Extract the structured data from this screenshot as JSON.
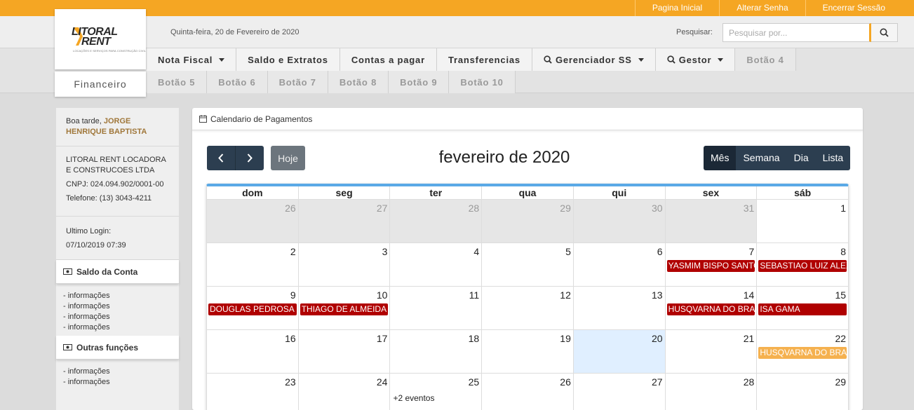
{
  "topbar": {
    "links": [
      "Pagina Inicial",
      "Alterar Senha",
      "Encerrar Sessão"
    ]
  },
  "header": {
    "date": "Quinta-feira, 20 de Fevereiro de 2020",
    "search_label": "Pesquisar:",
    "search_placeholder": "Pesquisar por..."
  },
  "logo": {
    "line1": "LITORAL",
    "line2": "RENT",
    "tagline": "LOCAÇÕES E SERVIÇOS PARA CONSTRUÇÃO CIVIL"
  },
  "section": "Financeiro",
  "nav": {
    "row1": [
      "Nota Fiscal",
      "Saldo e Extratos",
      "Contas a pagar",
      "Transferencias",
      "Gerenciador SS",
      "Gestor",
      "Botão 4"
    ],
    "row2": [
      "Botão 5",
      "Botão 6",
      "Botão 7",
      "Botão 8",
      "Botão 9",
      "Botão 10"
    ]
  },
  "sidebar": {
    "greeting": "Boa tarde,",
    "user_name": "JORGE HENRIQUE BAPTISTA",
    "company": "LITORAL RENT LOCADORA E CONSTRUCOES LTDA",
    "cnpj": "CNPJ: 024.094.902/0001-00",
    "phone": "Telefone: (13) 3043-4211",
    "last_login_label": "Ultimo Login:",
    "last_login_value": "07/10/2019 07:39",
    "panel1_title": "Saldo da Conta",
    "panel1_items": [
      "- informações",
      "- informações",
      "- informações",
      "- informações"
    ],
    "panel2_title": "Outras funções",
    "panel2_items": [
      "- informações",
      "- informações"
    ]
  },
  "calendar": {
    "panel_title": "Calendario de Pagamentos",
    "title": "fevereiro de 2020",
    "today_label": "Hoje",
    "views": [
      "Mês",
      "Semana",
      "Dia",
      "Lista"
    ],
    "active_view": "Mês",
    "weekdays": [
      "dom",
      "seg",
      "ter",
      "qua",
      "qui",
      "sex",
      "sáb"
    ],
    "weeks": [
      [
        "26",
        "27",
        "28",
        "29",
        "30",
        "31",
        "1"
      ],
      [
        "2",
        "3",
        "4",
        "5",
        "6",
        "7",
        "8"
      ],
      [
        "9",
        "10",
        "11",
        "12",
        "13",
        "14",
        "15"
      ],
      [
        "16",
        "17",
        "18",
        "19",
        "20",
        "21",
        "22"
      ],
      [
        "23",
        "24",
        "25",
        "26",
        "27",
        "28",
        "29"
      ]
    ],
    "events": {
      "w1_fri": "YASMIM BISPO SANTOS",
      "w1_sat": "SEBASTIAO LUIZ ALEXANDRE",
      "w2_sun": "DOUGLAS PEDROSA",
      "w2_mon": "THIAGO DE ALMEIDA",
      "w2_fri": "HUSQVARNA DO BRASIL",
      "w2_sat": "ISA GAMA",
      "w3_sat": "HUSQVARNA DO BRASIL"
    },
    "more_link": "+2 eventos",
    "colors": {
      "event_red": "#b00000",
      "event_orange": "#f5b14f",
      "today_bg": "#e0efff",
      "accent": "#f5a623"
    }
  }
}
